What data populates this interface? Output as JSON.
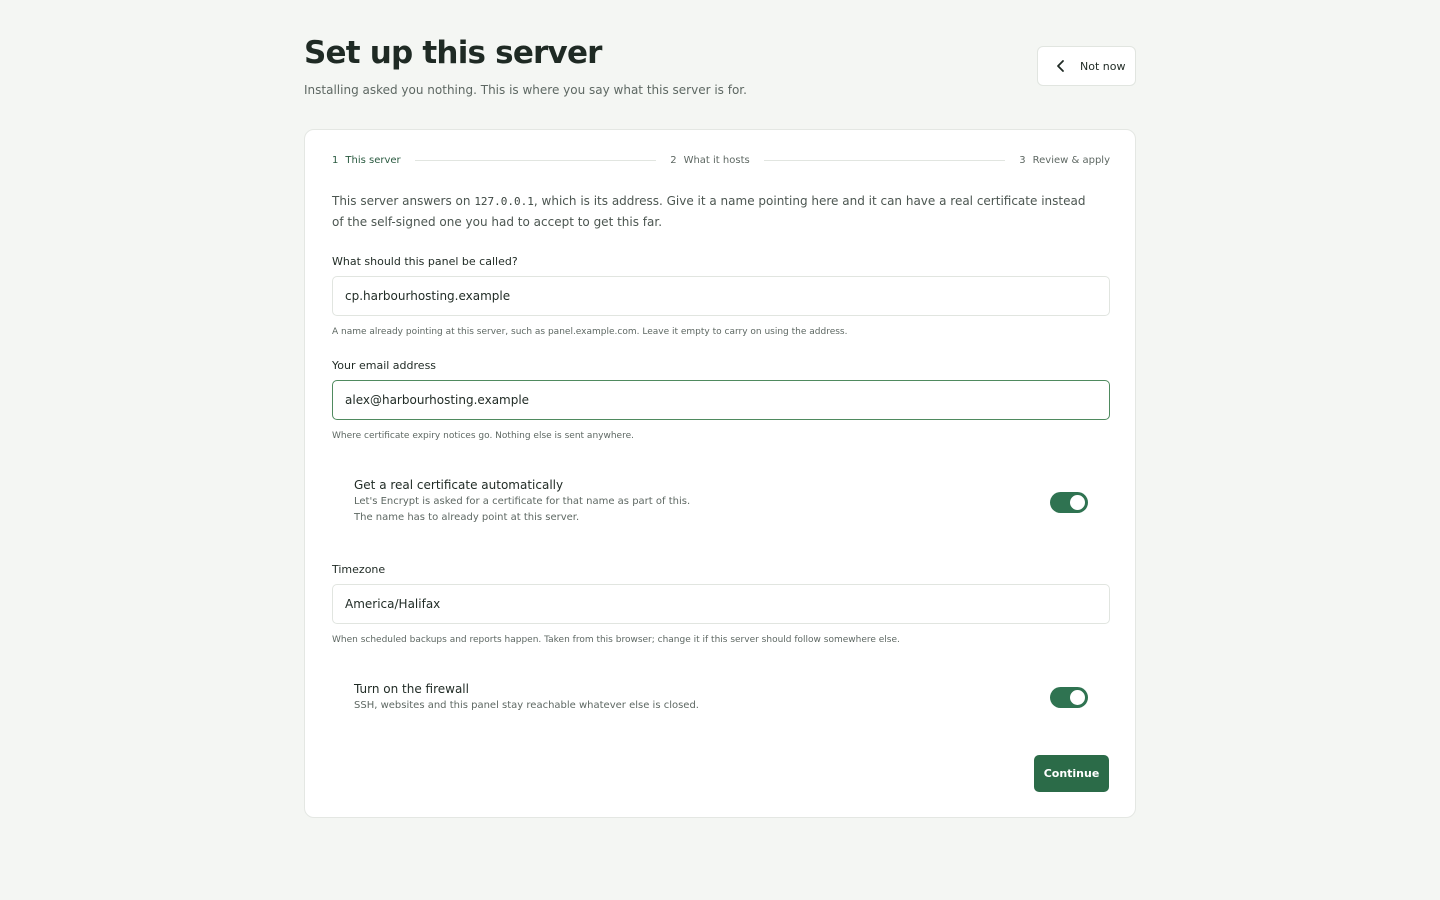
{
  "header": {
    "title": "Set up this server",
    "subtitle": "Installing asked you nothing. This is where you say what this server is for.",
    "not_now_label": "Not now",
    "not_now_icon": "chevron-left-icon"
  },
  "steps": [
    {
      "number": "1",
      "label": "This server",
      "active": true
    },
    {
      "number": "2",
      "label": "What it hosts",
      "active": false
    },
    {
      "number": "3",
      "label": "Review & apply",
      "active": false
    }
  ],
  "intro": {
    "before": "This server answers on ",
    "address": "127.0.0.1",
    "after": ", which is its address. Give it a name pointing here and it can have a real certificate instead of the self-signed one you had to accept to get this far."
  },
  "fields": {
    "panel_name": {
      "label": "What should this panel be called?",
      "value": "cp.harbourhosting.example",
      "hint": "A name already pointing at this server, such as panel.example.com. Leave it empty to carry on using the address."
    },
    "email": {
      "label": "Your email address",
      "value": "alex@harbourhosting.example",
      "hint": "Where certificate expiry notices go. Nothing else is sent anywhere."
    },
    "timezone": {
      "label": "Timezone",
      "value": "America/Halifax",
      "hint": "When scheduled backups and reports happen. Taken from this browser; change it if this server should follow somewhere else."
    }
  },
  "toggles": {
    "certificate": {
      "title": "Get a real certificate automatically",
      "description": "Let's Encrypt is asked for a certificate for that name as part of this. The name has to already point at this server.",
      "on": true
    },
    "firewall": {
      "title": "Turn on the firewall",
      "description": "SSH, websites and this panel stay reachable whatever else is closed.",
      "on": true
    }
  },
  "actions": {
    "continue_label": "Continue"
  },
  "colors": {
    "accent": "#2b6b48",
    "toggle_on": "#2f7351",
    "background": "#f4f6f3",
    "focus_border": "#4f8a5f"
  }
}
